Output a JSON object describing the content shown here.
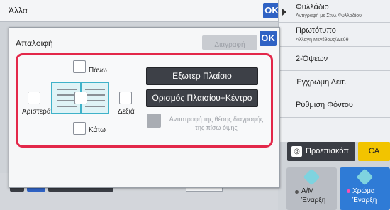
{
  "topbar": {
    "title": "Άλλα",
    "ok_label": "OK"
  },
  "dialog": {
    "title": "Απαλοιφή",
    "ok_label": "OK",
    "disabled_button_label": "Διαγραφή",
    "positions": {
      "top": "Πάνω",
      "left": "Αριστερά",
      "right": "Δεξιά",
      "bottom": "Κάτω"
    },
    "frame_button": "Εξωτερ Πλαίσιο",
    "frame_center_button": "Ορισμός Πλαισίου+Κέντρο",
    "reverse_label": "Αντιστροφή της θέσης διαγραφής της πίσω όψης"
  },
  "right_menu": [
    {
      "title": "Φυλλάδιο",
      "sub": "Αντιγραφή με Στυλ Φυλλαδίου"
    },
    {
      "title": "Πρωτότυπο",
      "sub": "Αλλαγή Μεγέθους/Διεύθ"
    },
    {
      "title": "2-Όψεων"
    },
    {
      "title": "Έγχρωμη Λειτ."
    },
    {
      "title": "Ρύθμιση Φόντου"
    }
  ],
  "preview_label": "Προεπισκόπ",
  "ca_label": "CA",
  "start_bw": {
    "line1": "Α/Μ",
    "line2": "Έναρξη"
  },
  "start_color": {
    "line1": "Χρώμα",
    "line2": "Έναρξη"
  },
  "bottom": {
    "prev_label": "Προηγούμεν",
    "paper_label": "A3"
  },
  "colors": {
    "accent": "#2f62c4",
    "highlight": "#e3284a",
    "teal": "#3fb2c9",
    "ca": "#f2c400"
  }
}
